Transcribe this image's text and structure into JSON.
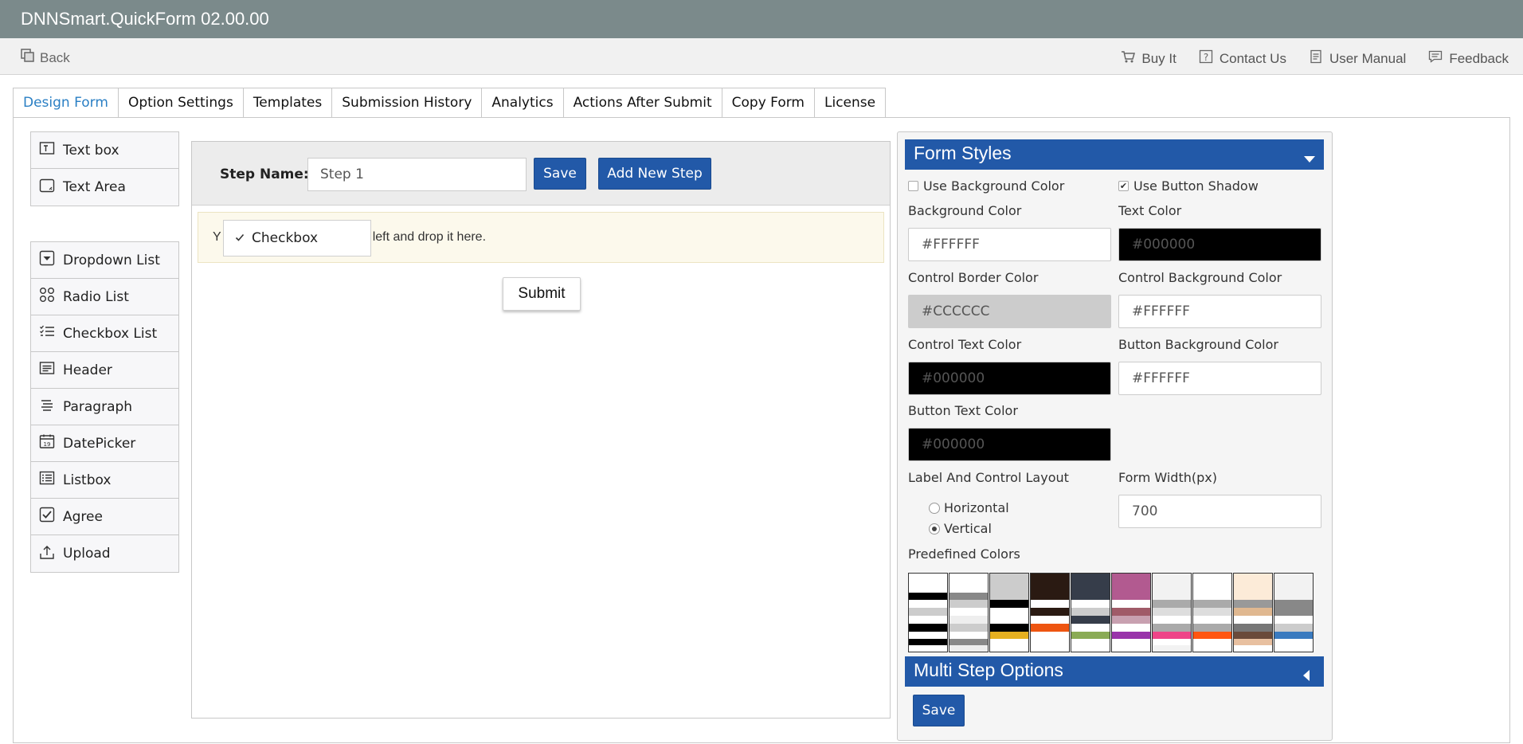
{
  "app": {
    "title": "DNNSmart.QuickForm 02.00.00"
  },
  "toolbar": {
    "back_label": "Back",
    "links": [
      "Buy It",
      "Contact Us",
      "User Manual",
      "Feedback"
    ]
  },
  "tabs": [
    "Design Form",
    "Option Settings",
    "Templates",
    "Submission History",
    "Analytics",
    "Actions After Submit",
    "Copy Form",
    "License"
  ],
  "active_tab": "Design Form",
  "palette": {
    "group1": [
      "Text box",
      "Text Area"
    ],
    "group2": [
      "Dropdown List",
      "Radio List",
      "Checkbox List",
      "Header",
      "Paragraph",
      "DatePicker",
      "Listbox",
      "Agree",
      "Upload"
    ]
  },
  "designer": {
    "step_label": "Step Name:",
    "step_value": "Step 1",
    "save_label": "Save",
    "add_step_label": "Add New Step",
    "drop_hint_start": "Y",
    "drop_hint_end": "n the left and drop it here.",
    "dragging_item": "Checkbox",
    "submit_label": "Submit"
  },
  "form_styles": {
    "title": "Form Styles",
    "use_bg_color": {
      "label": "Use Background Color",
      "checked": false
    },
    "use_btn_shadow": {
      "label": "Use Button Shadow",
      "checked": true
    },
    "fields": {
      "background_color": {
        "label": "Background Color",
        "value": "#FFFFFF"
      },
      "text_color": {
        "label": "Text Color",
        "value": "#000000"
      },
      "control_border_color": {
        "label": "Control Border Color",
        "value": "#CCCCCC"
      },
      "control_bg_color": {
        "label": "Control Background Color",
        "value": "#FFFFFF"
      },
      "control_text_color": {
        "label": "Control Text Color",
        "value": "#000000"
      },
      "button_bg_color": {
        "label": "Button Background Color",
        "value": "#FFFFFF"
      },
      "button_text_color": {
        "label": "Button Text Color",
        "value": "#000000"
      }
    },
    "layout_label": "Label And Control Layout",
    "layout_options": [
      "Horizontal",
      "Vertical"
    ],
    "layout_selected": "Vertical",
    "form_width_label": "Form Width(px)",
    "form_width_value": "700",
    "predefined_label": "Predefined Colors",
    "swatches": [
      [
        "#ffffff",
        "#000000",
        "#ffffff",
        "#cccccc",
        "#ffffff",
        "#000000",
        "#ffffff",
        "#000000",
        "#ffffff"
      ],
      [
        "#ffffff",
        "#888888",
        "#cccccc",
        "#ffffff",
        "#eeeeee",
        "#cccccc",
        "#ffffff",
        "#888888",
        "#eeeeee"
      ],
      [
        "#cccccc",
        "#cccccc",
        "#000000",
        "#ffffff",
        "#ffffff",
        "#000000",
        "#e6b020",
        "#ffffff",
        "#ffffff"
      ],
      [
        "#2a1a12",
        "#2a1a12",
        "#ffffff",
        "#2a1a12",
        "#ffffff",
        "#ee5511",
        "#ffffff",
        "#ffffff",
        "#ffffff"
      ],
      [
        "#363d4a",
        "#363d4a",
        "#ffffff",
        "#cccccc",
        "#363d4a",
        "#ffffff",
        "#8aab55",
        "#ffffff",
        "#ffffff"
      ],
      [
        "#b25a90",
        "#b25a90",
        "#ffffff",
        "#a05a68",
        "#c8a0b0",
        "#ffffff",
        "#9933aa",
        "#ffffff",
        "#ffffff"
      ],
      [
        "#f2f2f2",
        "#f2f2f2",
        "#aaaaaa",
        "#dddddd",
        "#ffffff",
        "#aaaaaa",
        "#ee4488",
        "#ffffff",
        "#f2f2f2"
      ],
      [
        "#ffffff",
        "#ffffff",
        "#aaaaaa",
        "#dddddd",
        "#ffffff",
        "#aaaaaa",
        "#ff5511",
        "#ffffff",
        "#ffffff"
      ],
      [
        "#fcebd8",
        "#fcebd8",
        "#999999",
        "#e0b890",
        "#ffffff",
        "#777777",
        "#6a4a3a",
        "#e8c0a0",
        "#ffffff"
      ],
      [
        "#f2f2f2",
        "#f2f2f2",
        "#888888",
        "#888888",
        "#ffffff",
        "#cccccc",
        "#3a7abf",
        "#ffffff",
        "#ffffff"
      ]
    ]
  },
  "multi_step": {
    "title": "Multi Step Options",
    "save_label": "Save"
  },
  "colors": {
    "accent": "#2259a8",
    "title_bar": "#7b8a8b",
    "active_tab": "#2a7fc4",
    "drop_zone": "#fcf9ec"
  }
}
